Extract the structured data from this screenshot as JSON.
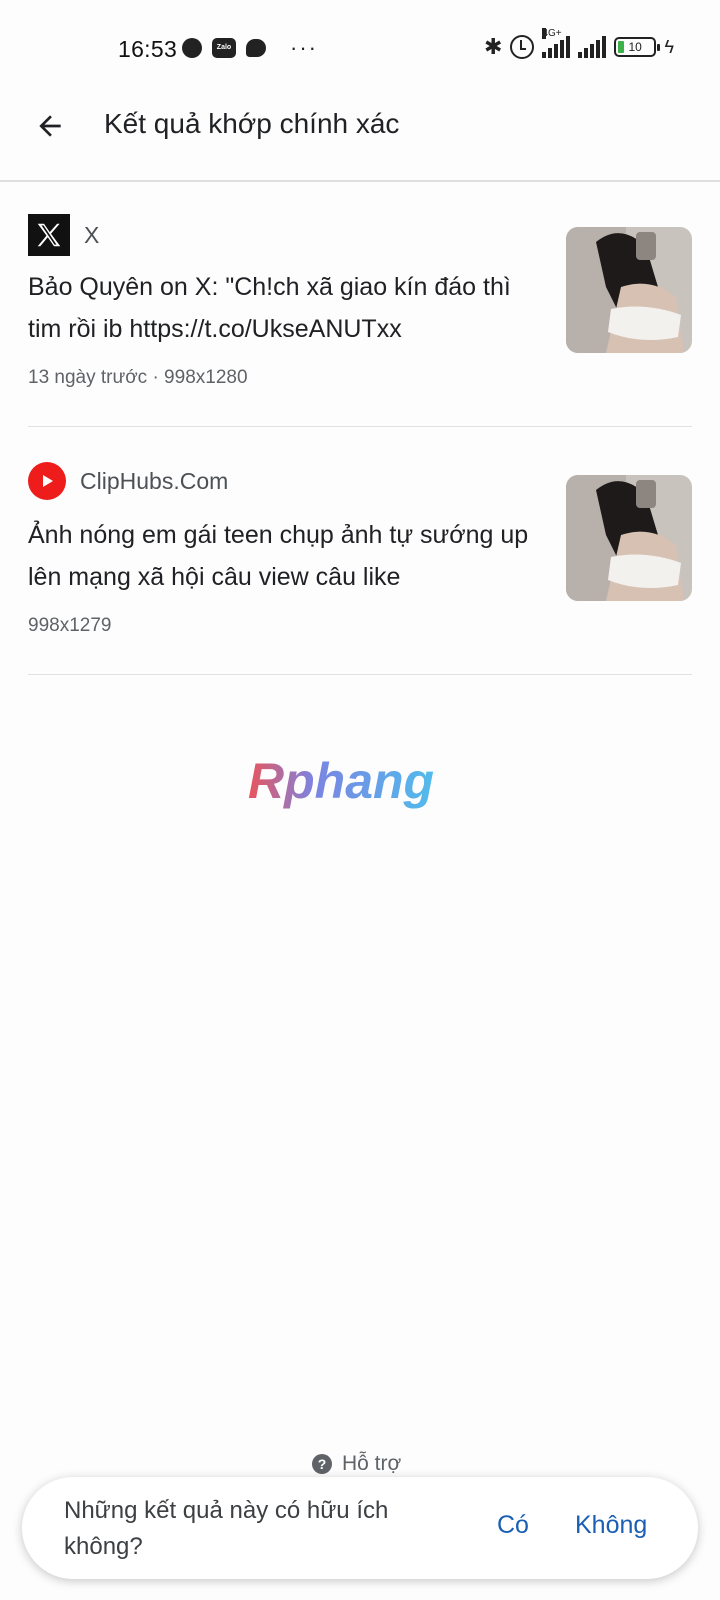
{
  "status_bar": {
    "time": "16:53",
    "network_label": "4G+",
    "battery": "10"
  },
  "app_bar": {
    "title": "Kết quả khớp chính xác"
  },
  "results": [
    {
      "source": "X",
      "title": "Bảo Quyên on X: \"Ch!ch xã giao kín đáo thì tim rồi ib https://t.co/UkseANUTxx",
      "meta": "13 ngày trước · 998x1280"
    },
    {
      "source": "ClipHubs.Com",
      "title": "Ảnh nóng em gái teen chụp ảnh tự sướng up lên mạng xã hội câu view câu like",
      "meta": "998x1279"
    }
  ],
  "watermark": "Rphang",
  "help": {
    "label": "Hỗ trợ"
  },
  "feedback": {
    "question": "Những kết quả này có hữu ích không?",
    "yes": "Có",
    "no": "Không"
  },
  "colors": {
    "accent": "#1a5fb4",
    "youtube_red": "#ee1c1b",
    "battery_green": "#3db24a"
  }
}
